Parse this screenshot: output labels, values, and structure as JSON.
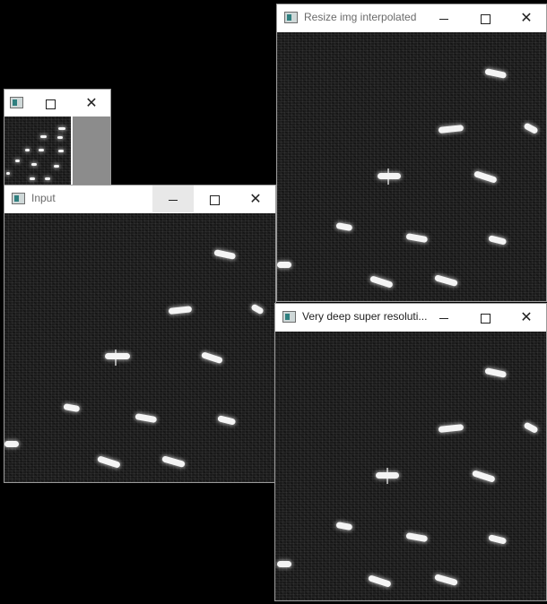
{
  "windows": {
    "small": {
      "title": ""
    },
    "input": {
      "title": "Input"
    },
    "resize": {
      "title": "Resize img interpolated"
    },
    "vdsr": {
      "title": "Very deep super resoluti..."
    }
  },
  "icons": {
    "app": "opencv-window-icon",
    "minimize": "minimize-icon",
    "maximize": "maximize-icon",
    "close": "close-icon"
  },
  "colors": {
    "desktop": "#000000",
    "titlebar": "#ffffff",
    "image_background": "#1b1b1b",
    "blob": "#f4f4f4"
  }
}
